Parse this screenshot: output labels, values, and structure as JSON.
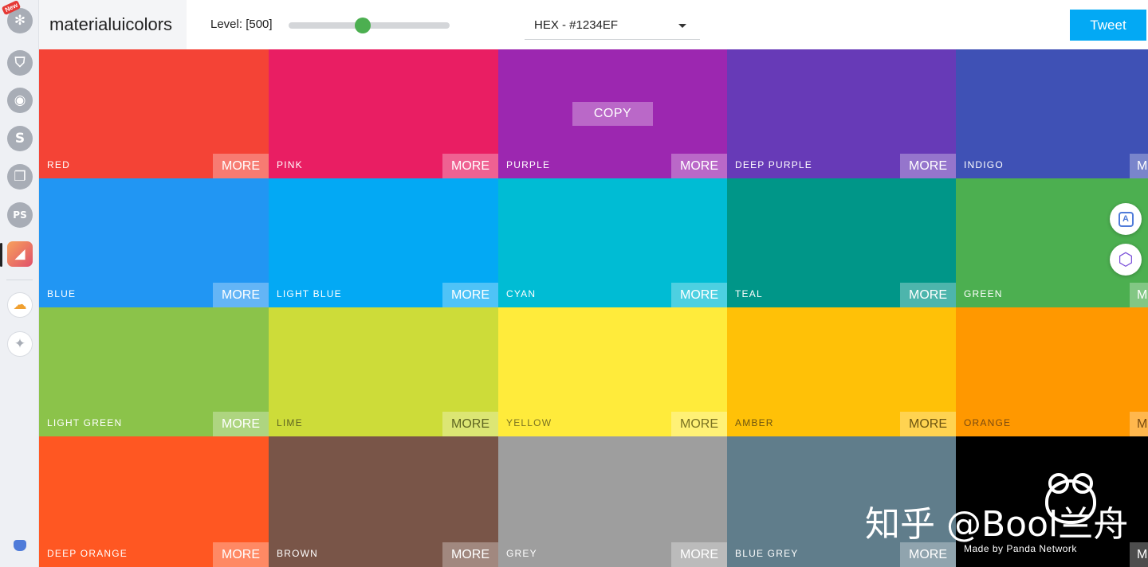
{
  "sidebar": {
    "new_badge": "New",
    "icons": [
      "flower-icon",
      "shield-icon",
      "palette-icon",
      "s-letter-icon",
      "stack-icon",
      "pf-icon",
      "materialui-app-icon",
      "cloud-icon",
      "sparkle-icon"
    ],
    "ps_label": "PS"
  },
  "header": {
    "title": "materialuicolors",
    "level_label": "Level: [500]",
    "level_fraction": 0.46,
    "format_value": "HEX - #1234EF",
    "tweet_label": "Tweet"
  },
  "colors": [
    {
      "name": "RED",
      "hex": "#F44336",
      "text": "#ffffff"
    },
    {
      "name": "PINK",
      "hex": "#E91E63",
      "text": "#ffffff"
    },
    {
      "name": "PURPLE",
      "hex": "#9C27B0",
      "text": "#ffffff"
    },
    {
      "name": "DEEP PURPLE",
      "hex": "#673AB7",
      "text": "#ffffff"
    },
    {
      "name": "INDIGO",
      "hex": "#3F51B5",
      "text": "#ffffff",
      "more": "M"
    },
    {
      "name": "BLUE",
      "hex": "#2196F3",
      "text": "#ffffff"
    },
    {
      "name": "LIGHT BLUE",
      "hex": "#03A9F4",
      "text": "#ffffff"
    },
    {
      "name": "CYAN",
      "hex": "#00BCD4",
      "text": "#ffffff"
    },
    {
      "name": "TEAL",
      "hex": "#009688",
      "text": "#ffffff"
    },
    {
      "name": "GREEN",
      "hex": "#4CAF50",
      "text": "#ffffff",
      "more": "M"
    },
    {
      "name": "LIGHT GREEN",
      "hex": "#8BC34A",
      "text": "#ffffff"
    },
    {
      "name": "LIME",
      "hex": "#CDDC39",
      "text": "#5f6521"
    },
    {
      "name": "YELLOW",
      "hex": "#FFEB3B",
      "text": "#7a7221"
    },
    {
      "name": "AMBER",
      "hex": "#FFC107",
      "text": "#6e5510"
    },
    {
      "name": "ORANGE",
      "hex": "#FF9800",
      "text": "#7a4a10",
      "more": "M"
    },
    {
      "name": "DEEP ORANGE",
      "hex": "#FF5722",
      "text": "#ffffff"
    },
    {
      "name": "BROWN",
      "hex": "#795548",
      "text": "#ffffff"
    },
    {
      "name": "GREY",
      "hex": "#9E9E9E",
      "text": "#ffffff"
    },
    {
      "name": "BLUE GREY",
      "hex": "#607D8B",
      "text": "#ffffff"
    },
    {
      "name": "",
      "hex": "#000000",
      "text": "#ffffff",
      "more": "M"
    }
  ],
  "more_label": "MORE",
  "copy_label": "COPY",
  "copy_cell": 2,
  "made_by": "Made by Panda Network",
  "floating": {
    "translate_icon": "translate-icon",
    "translate_glyph": "A",
    "extension_icon": "hexagon-icon",
    "extension_glyph": "⬡"
  },
  "watermark": "知乎 @Bool兰舟"
}
